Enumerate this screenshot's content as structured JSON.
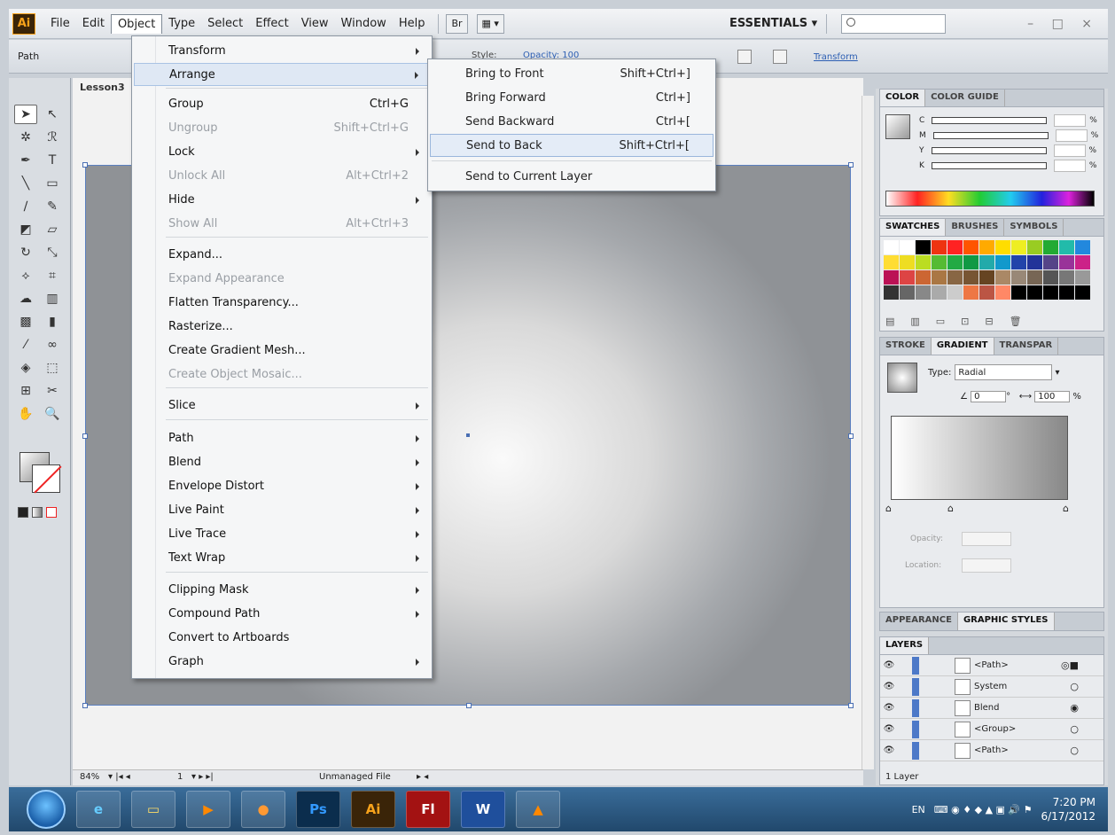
{
  "menubar": {
    "logo": "Ai",
    "items": [
      "File",
      "Edit",
      "Object",
      "Type",
      "Select",
      "Effect",
      "View",
      "Window",
      "Help"
    ],
    "bridge_btn": "Br",
    "workspace": "ESSENTIALS"
  },
  "controlbar": {
    "selection_label": "Path",
    "style_label": "Style:",
    "opacity_label": "Opacity: 100",
    "transform_link": "Transform"
  },
  "document": {
    "tab_title": "Lesson3",
    "zoom": "84%",
    "page": "1",
    "file_status": "Unmanaged File"
  },
  "object_menu": {
    "items": [
      {
        "label": "Transform",
        "shortcut": "",
        "submenu": true,
        "enabled": true
      },
      {
        "label": "Arrange",
        "shortcut": "",
        "submenu": true,
        "enabled": true,
        "highlighted": true
      },
      {
        "label": "Group",
        "shortcut": "Ctrl+G",
        "submenu": false,
        "enabled": true
      },
      {
        "label": "Ungroup",
        "shortcut": "Shift+Ctrl+G",
        "submenu": false,
        "enabled": false
      },
      {
        "label": "Lock",
        "shortcut": "",
        "submenu": true,
        "enabled": true
      },
      {
        "label": "Unlock All",
        "shortcut": "Alt+Ctrl+2",
        "submenu": false,
        "enabled": false
      },
      {
        "label": "Hide",
        "shortcut": "",
        "submenu": true,
        "enabled": true
      },
      {
        "label": "Show All",
        "shortcut": "Alt+Ctrl+3",
        "submenu": false,
        "enabled": false
      },
      {
        "label": "Expand...",
        "shortcut": "",
        "submenu": false,
        "enabled": true
      },
      {
        "label": "Expand Appearance",
        "shortcut": "",
        "submenu": false,
        "enabled": false
      },
      {
        "label": "Flatten Transparency...",
        "shortcut": "",
        "submenu": false,
        "enabled": true
      },
      {
        "label": "Rasterize...",
        "shortcut": "",
        "submenu": false,
        "enabled": true
      },
      {
        "label": "Create Gradient Mesh...",
        "shortcut": "",
        "submenu": false,
        "enabled": true
      },
      {
        "label": "Create Object Mosaic...",
        "shortcut": "",
        "submenu": false,
        "enabled": false
      },
      {
        "label": "Slice",
        "shortcut": "",
        "submenu": true,
        "enabled": true
      },
      {
        "label": "Path",
        "shortcut": "",
        "submenu": true,
        "enabled": true
      },
      {
        "label": "Blend",
        "shortcut": "",
        "submenu": true,
        "enabled": true
      },
      {
        "label": "Envelope Distort",
        "shortcut": "",
        "submenu": true,
        "enabled": true
      },
      {
        "label": "Live Paint",
        "shortcut": "",
        "submenu": true,
        "enabled": true
      },
      {
        "label": "Live Trace",
        "shortcut": "",
        "submenu": true,
        "enabled": true
      },
      {
        "label": "Text Wrap",
        "shortcut": "",
        "submenu": true,
        "enabled": true
      },
      {
        "label": "Clipping Mask",
        "shortcut": "",
        "submenu": true,
        "enabled": true
      },
      {
        "label": "Compound Path",
        "shortcut": "",
        "submenu": true,
        "enabled": true
      },
      {
        "label": "Convert to Artboards",
        "shortcut": "",
        "submenu": false,
        "enabled": true
      },
      {
        "label": "Graph",
        "shortcut": "",
        "submenu": true,
        "enabled": true
      }
    ]
  },
  "arrange_submenu": {
    "items": [
      {
        "label": "Bring to Front",
        "shortcut": "Shift+Ctrl+]"
      },
      {
        "label": "Bring Forward",
        "shortcut": "Ctrl+]"
      },
      {
        "label": "Send Backward",
        "shortcut": "Ctrl+["
      },
      {
        "label": "Send to Back",
        "shortcut": "Shift+Ctrl+[",
        "highlighted": true
      },
      {
        "label": "Send to Current Layer",
        "shortcut": ""
      }
    ]
  },
  "color_panel": {
    "tabs": [
      "COLOR",
      "COLOR GUIDE"
    ],
    "channels": [
      "C",
      "M",
      "Y",
      "K"
    ],
    "unit": "%"
  },
  "swatches_panel": {
    "tabs": [
      "SWATCHES",
      "BRUSHES",
      "SYMBOLS"
    ]
  },
  "gradient_panel": {
    "tabs": [
      "STROKE",
      "GRADIENT",
      "TRANSPAR"
    ],
    "type_label": "Type:",
    "type_value": "Radial",
    "angle": "0",
    "aspect": "100",
    "unit": "%",
    "opacity_label": "Opacity:",
    "location_label": "Location:"
  },
  "appearance_panel": {
    "tabs": [
      "APPEARANCE",
      "GRAPHIC STYLES"
    ]
  },
  "layers_panel": {
    "tab": "LAYERS",
    "rows": [
      "<Path>",
      "System",
      "Blend",
      "<Group>",
      "<Path>"
    ],
    "footer": "1 Layer"
  },
  "taskbar": {
    "apps": [
      "IE",
      "Explorer",
      "Media",
      "Firefox",
      "Ps",
      "Ai",
      "Fl",
      "W",
      "VLC"
    ],
    "lang": "EN",
    "time": "7:20 PM",
    "date": "6/17/2012"
  },
  "colors": {
    "accent": "#4a6fb3",
    "menu_highlight": "#dfe8f4"
  }
}
